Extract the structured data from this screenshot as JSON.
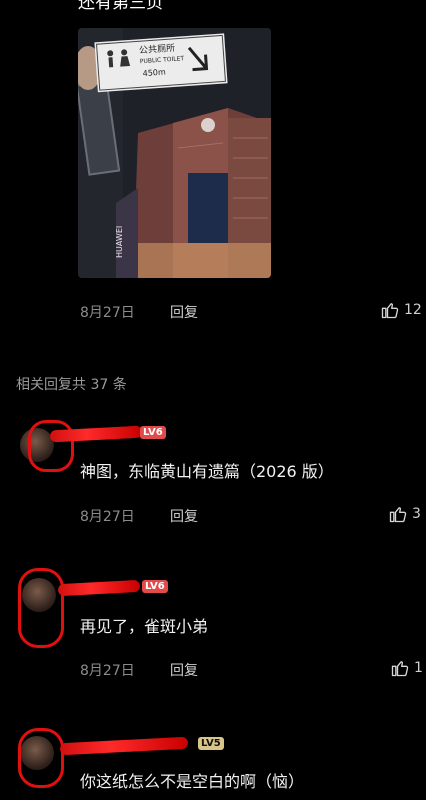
{
  "top_comment": {
    "text_partial": "还有第三页",
    "date": "8月27日",
    "reply_label": "回复",
    "like_count": "12"
  },
  "photo_sign": {
    "line1": "公共厕所",
    "line2": "PUBLIC TOILET",
    "line3": "450m",
    "brand": "HUAWEI"
  },
  "replies_header": "相关回复共 37 条",
  "replies": [
    {
      "level": "LV6",
      "text": "神图，东临黄山有遗篇（2026 版）",
      "date": "8月27日",
      "reply_label": "回复",
      "like_count": "3"
    },
    {
      "level": "LV6",
      "text": "再见了，雀斑小弟",
      "date": "8月27日",
      "reply_label": "回复",
      "like_count": "1"
    },
    {
      "level": "LV5",
      "text": "你这纸怎么不是空白的啊（恼）",
      "date": "",
      "reply_label": "",
      "like_count": ""
    }
  ]
}
